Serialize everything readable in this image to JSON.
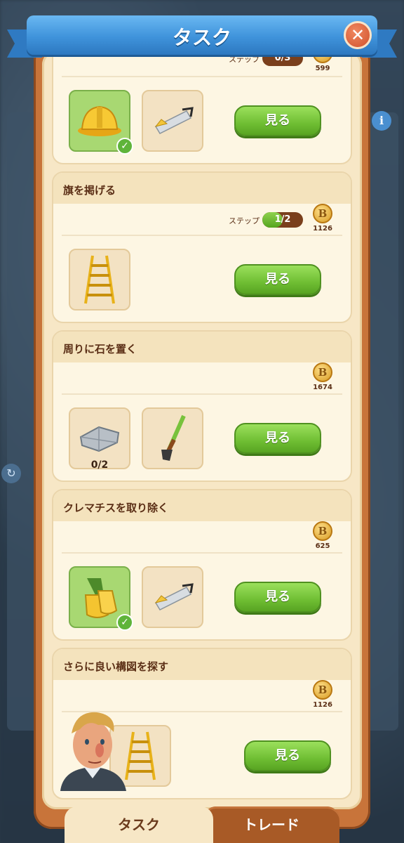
{
  "header": {
    "title": "タスク"
  },
  "tasks": [
    {
      "title": "",
      "step_label": "ステップ",
      "step_text": "0/3",
      "step_progress": 0,
      "reward": "599",
      "items": [
        {
          "icon": "hard-hat-icon",
          "done": true,
          "count": ""
        },
        {
          "icon": "saw-icon",
          "done": false,
          "count": ""
        }
      ],
      "button": "見る"
    },
    {
      "title": "旗を掲げる",
      "step_label": "ステップ",
      "step_text": "1/2",
      "step_progress": 0.5,
      "reward": "1126",
      "items": [
        {
          "icon": "ladder-icon",
          "done": false,
          "count": ""
        }
      ],
      "button": "見る"
    },
    {
      "title": "周りに石を置く",
      "reward": "1674",
      "items": [
        {
          "icon": "stone-slab-icon",
          "done": false,
          "count": "0/2"
        },
        {
          "icon": "hoe-icon",
          "done": false,
          "count": ""
        }
      ],
      "button": "見る"
    },
    {
      "title": "クレマチスを取り除く",
      "reward": "625",
      "items": [
        {
          "icon": "gloves-icon",
          "done": true,
          "count": ""
        },
        {
          "icon": "saw-icon",
          "done": false,
          "count": ""
        }
      ],
      "button": "見る"
    },
    {
      "title": "さらに良い構図を探す",
      "reward": "1126",
      "items": [
        {
          "icon": "ladder-icon",
          "done": false,
          "count": ""
        }
      ],
      "button": "見る"
    }
  ],
  "tabs": {
    "active": "タスク",
    "inactive": "トレード"
  },
  "colors": {
    "accent_green": "#6fbe33",
    "frame_orange": "#c8743a",
    "ribbon_blue": "#3f93db"
  }
}
